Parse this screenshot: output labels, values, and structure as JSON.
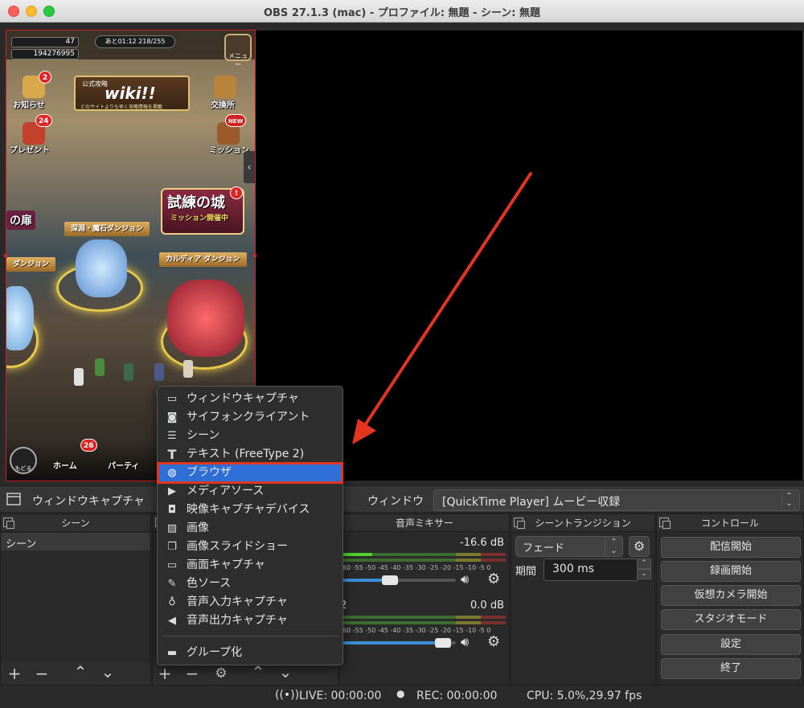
{
  "window": {
    "title": "OBS 27.1.3 (mac) - プロファイル: 無題 - シーン: 無題"
  },
  "game": {
    "stat1": "47",
    "stat2": "194276995",
    "time": "あと01:12 218/255",
    "menu": "メニュー",
    "news": "お知らせ",
    "news_badge": "2",
    "present": "プレゼント",
    "present_badge": "24",
    "exchange": "交換所",
    "mission": "ミッション",
    "mission_badge": "NEW",
    "wiki_l1": "公式攻略",
    "wiki_l2": "wiki!!",
    "wiki_l3": "どのサイトよりも早く攻略情報を掲載",
    "castle_big": "試練の城",
    "castle_small": "ミッション開催中",
    "castle_badge": "!",
    "left_gate": "の扉",
    "dungeon1": "深淵・魔石ダンジョン",
    "dungeon2": "カルディア ダンジョン",
    "dungeon3": "ダンジョン",
    "back": "もどる",
    "home": "ホーム",
    "home_badge": "26",
    "party": "パーティ"
  },
  "source_toolbar": {
    "source_name": "ウィンドウキャプチャ",
    "window_label": "ウィンドウ",
    "window_value": "[QuickTime Player] ムービー収録"
  },
  "docks": {
    "scenes": {
      "title": "シーン",
      "items": [
        "シーン"
      ]
    },
    "mixer": {
      "title": "音声ミキサー",
      "ch1_db": "-16.6 dB",
      "ch2_num": "2",
      "ch2_db": "0.0 dB",
      "ticks": "-60  -55  -50  -45  -40  -35  -30  -25  -20  -15  -10   -5   0",
      "ch1_level": 0.2,
      "ch1_volume": 0.42,
      "ch2_level": 0.0,
      "ch2_volume": 0.95
    },
    "transitions": {
      "title": "シーントランジション",
      "selected": "フェード",
      "duration_label": "期間",
      "duration_value": "300 ms"
    },
    "controls": {
      "title": "コントロール",
      "buttons": [
        "配信開始",
        "録画開始",
        "仮想カメラ開始",
        "スタジオモード",
        "設定",
        "終了"
      ]
    }
  },
  "context_menu": {
    "items": [
      {
        "label": "ウィンドウキャプチャ",
        "icon": "window-icon"
      },
      {
        "label": "サイフォンクライアント",
        "icon": "gamepad-icon"
      },
      {
        "label": "シーン",
        "icon": "list-icon"
      },
      {
        "label": "テキスト (FreeType 2)",
        "icon": "text-icon"
      },
      {
        "label": "ブラウザ",
        "icon": "globe-icon"
      },
      {
        "label": "メディアソース",
        "icon": "play-icon"
      },
      {
        "label": "映像キャプチャデバイス",
        "icon": "camera-icon"
      },
      {
        "label": "画像",
        "icon": "image-icon"
      },
      {
        "label": "画像スライドショー",
        "icon": "slideshow-icon"
      },
      {
        "label": "画面キャプチャ",
        "icon": "monitor-icon"
      },
      {
        "label": "色ソース",
        "icon": "brush-icon"
      },
      {
        "label": "音声入力キャプチャ",
        "icon": "microphone-icon"
      },
      {
        "label": "音声出力キャプチャ",
        "icon": "speaker-icon"
      }
    ],
    "group": {
      "label": "グループ化",
      "icon": "folder-icon"
    },
    "selected_index": 4
  },
  "status": {
    "live": "LIVE: 00:00:00",
    "rec": "REC: 00:00:00",
    "cpu": "CPU: 5.0%,29.97 fps"
  },
  "colors": {
    "highlight": "#2d6fd6",
    "annotation": "#e2341f"
  }
}
